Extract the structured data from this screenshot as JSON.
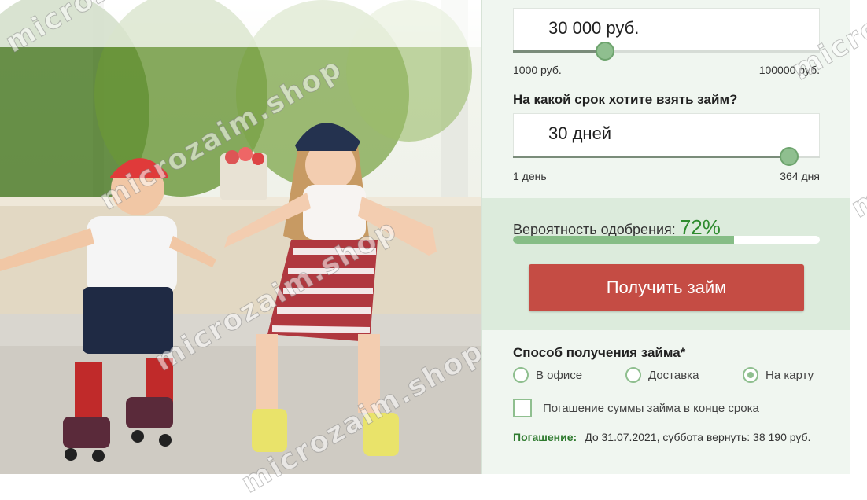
{
  "amount": {
    "value": "30 000 руб.",
    "min": "1000 руб.",
    "max": "100000 руб.",
    "level_fraction": 0.3
  },
  "term": {
    "question": "На какой срок хотите взять займ?",
    "value": "30 дней",
    "min": "1 день",
    "max": "364 дня",
    "level_fraction": 0.9
  },
  "approval": {
    "label": "Вероятность одобрения:",
    "value": "72%",
    "level_fraction": 0.72
  },
  "cta": {
    "label": "Получить займ",
    "color": "#c54c44"
  },
  "method": {
    "title": "Способ получения займа*",
    "options": [
      {
        "label": "В офисе",
        "checked": false
      },
      {
        "label": "Доставка",
        "checked": false
      },
      {
        "label": "На карту",
        "checked": true
      }
    ]
  },
  "repayment_checkbox": {
    "label": "Погашение суммы займа в конце срока",
    "checked": false
  },
  "repayment": {
    "label": "Погашение:",
    "text": "До 31.07.2021, суббота вернуть: 38 190 руб."
  },
  "watermark": "microzaim.shop",
  "colors": {
    "accent_green": "#8fbf8f",
    "approval_text": "#2e8b2e",
    "panel_bg": "#f0f6f0"
  }
}
